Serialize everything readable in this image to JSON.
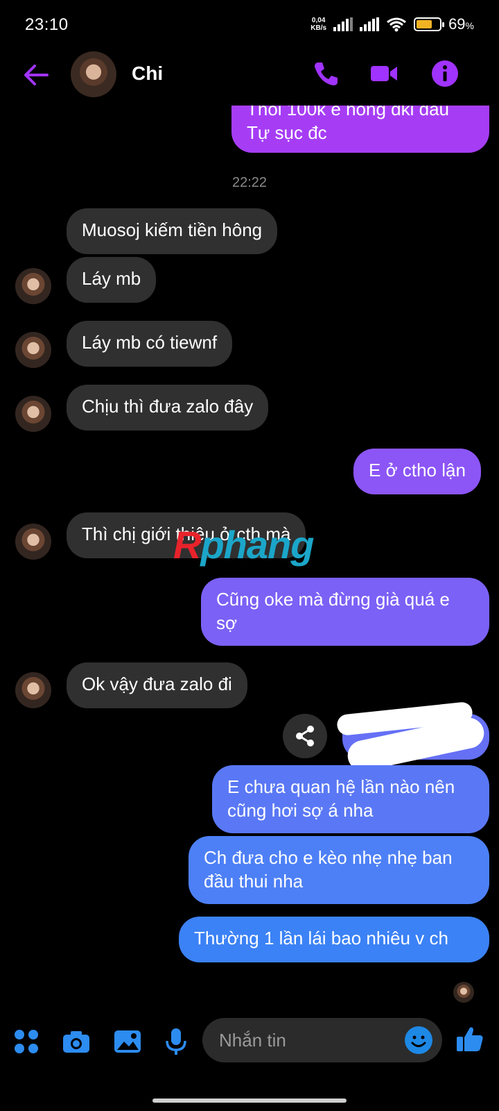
{
  "status": {
    "time": "23:10",
    "speed_value": "0,04",
    "speed_unit": "KB/s",
    "battery": "69",
    "battery_unit": "%",
    "battery_level": 0.69
  },
  "header": {
    "name": "Chi"
  },
  "chat": {
    "partial_top_line1": "Thôi 100k e hông dki đâu",
    "partial_top_line2": "Tự sục đc",
    "timestamp": "22:22",
    "m1": "Muosoj kiếm tiền hông",
    "m2": "Láy mb",
    "m3": "Láy mb có tiewnf",
    "m4": "Chịu thì đưa zalo đây",
    "m5": "E ở ctho lận",
    "m6": "Thì chị giới thiệu ở cth mà",
    "m7_line1": "Cũng oke mà đừng già quá e",
    "m7_line2": "sợ",
    "m8": "Ok vậy đưa zalo đi",
    "m9_line1": "E chưa quan hệ lần nào nên",
    "m9_line2": "cũng hơi sợ á nha",
    "m10_line1": "Ch đưa cho e kèo nhẹ nhẹ ban",
    "m10_line2": "đầu thui nha",
    "m11": "Thường 1 lần lái bao nhiêu v ch"
  },
  "watermark": {
    "part1": "R",
    "part2": "phang"
  },
  "composer": {
    "placeholder": "Nhắn tin"
  },
  "colors": {
    "accent": "#a033ff",
    "bubble_in": "#303030",
    "purple": "#9a4cf5",
    "blue": "#3b82f6"
  }
}
